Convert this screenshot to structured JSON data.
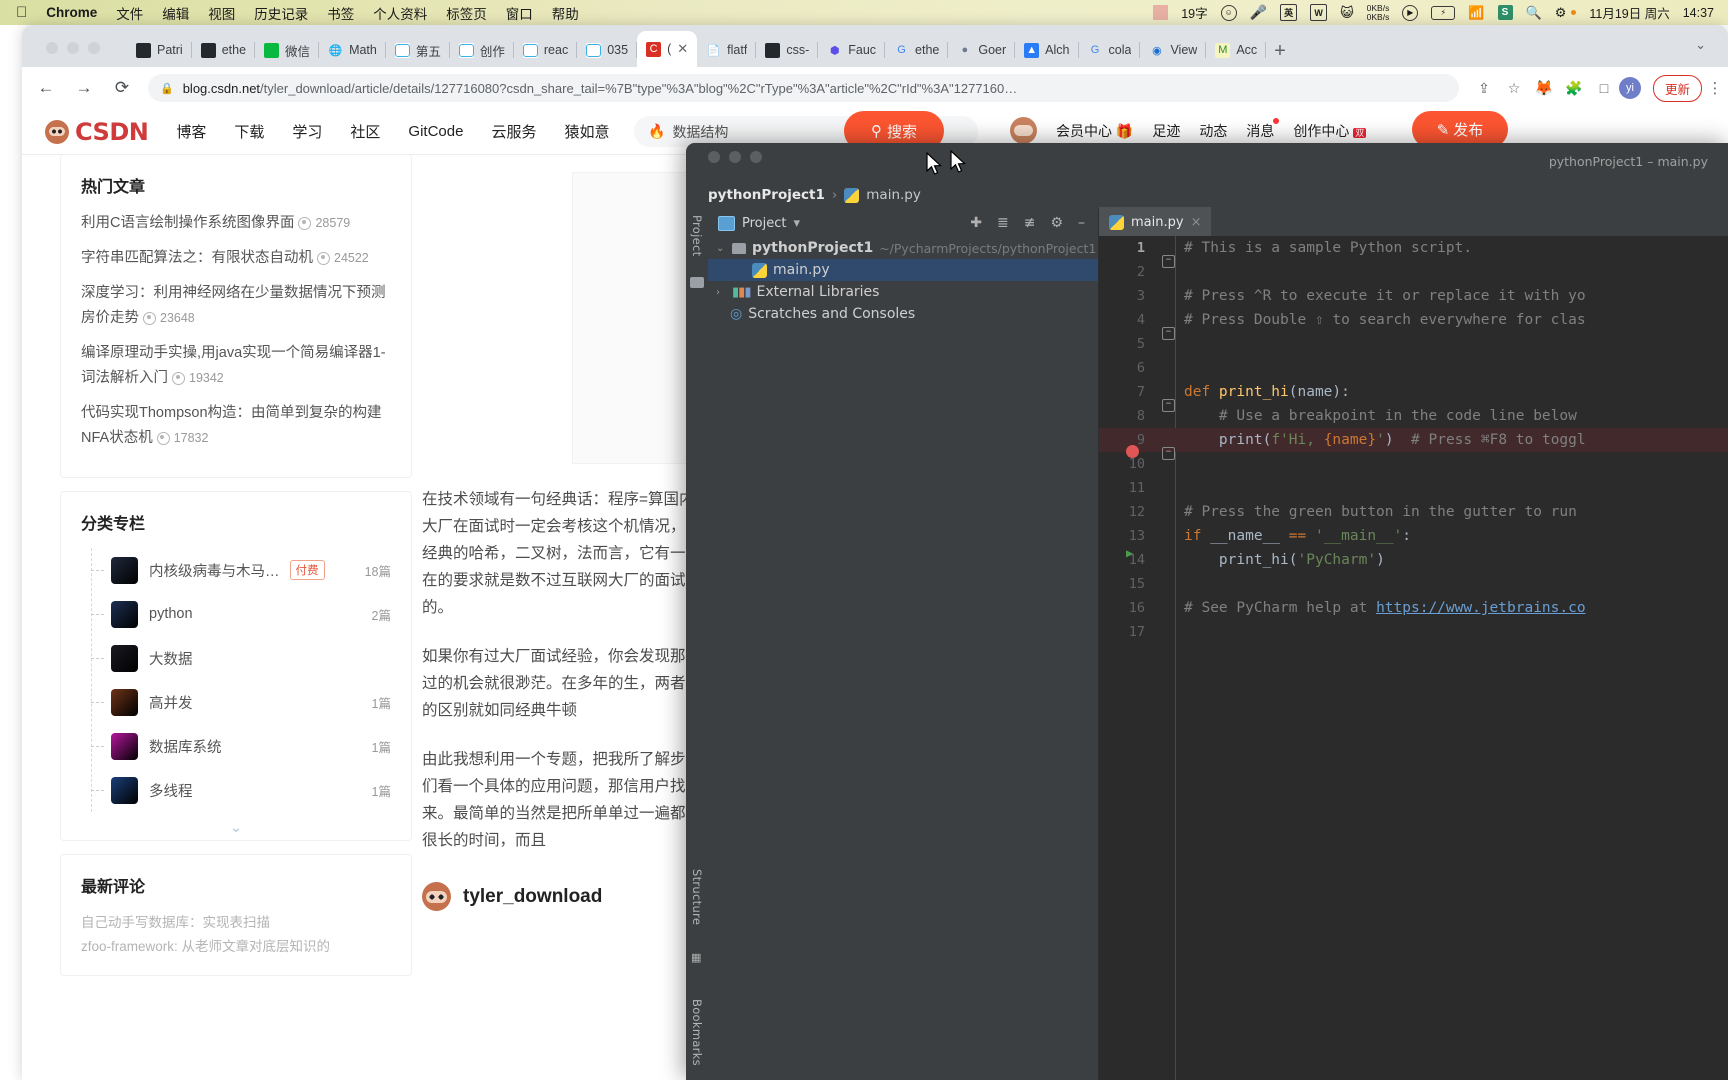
{
  "menubar": {
    "apple": "apple-logo",
    "items": [
      "Chrome",
      "文件",
      "编辑",
      "视图",
      "历史记录",
      "书签",
      "个人资料",
      "标签页",
      "窗口",
      "帮助"
    ],
    "tray": {
      "word_count": "19字",
      "input_method": "英",
      "word_app": "W",
      "netspeed_up": "0KB/s",
      "netspeed_down": "0KB/s",
      "sogou": "S",
      "date": "11月19日 周六",
      "time": "14:37"
    }
  },
  "chrome": {
    "tabs": [
      {
        "icon": "github",
        "label": "Patri"
      },
      {
        "icon": "github",
        "label": "ethe"
      },
      {
        "icon": "wechat",
        "label": "微信"
      },
      {
        "icon": "globe",
        "label": "Math"
      },
      {
        "icon": "bilibili",
        "label": "第五"
      },
      {
        "icon": "bilibili",
        "label": "创作"
      },
      {
        "icon": "bilibili",
        "label": "reac"
      },
      {
        "icon": "bilibili",
        "label": "035"
      },
      {
        "icon": "csdn",
        "label": "(",
        "active": true
      },
      {
        "icon": "doc",
        "label": "flatf"
      },
      {
        "icon": "github",
        "label": "css-"
      },
      {
        "icon": "faucet",
        "label": "Fauc"
      },
      {
        "icon": "google",
        "label": "ethe"
      },
      {
        "icon": "goer",
        "label": "Goer"
      },
      {
        "icon": "alch",
        "label": "Alch"
      },
      {
        "icon": "google",
        "label": "cola"
      },
      {
        "icon": "view",
        "label": "View"
      },
      {
        "icon": "acco",
        "label": "Acc"
      }
    ],
    "new_tab": "+",
    "tab_list": "⌄",
    "nav": {
      "back": "←",
      "forward": "→",
      "reload": "⟳"
    },
    "omnibox": {
      "lock": "lock-icon",
      "host": "blog.csdn.net",
      "path": "/tyler_download/article/details/127716080?csdn_share_tail=%7B\"type\"%3A\"blog\"%2C\"rType\"%3A\"article\"%2C\"rId\"%3A\"1277160…"
    },
    "toolbar_icons": [
      "share-icon",
      "bookmark-star-icon",
      "metamask-icon",
      "extensions-icon",
      "sidepanel-icon"
    ],
    "profile_initial": "yi",
    "update_label": "更新",
    "kebab": "⋮"
  },
  "csdn": {
    "logo_text": "CSDN",
    "nav": [
      "博客",
      "下载",
      "学习",
      "社区",
      "GitCode",
      "云服务",
      "猿如意"
    ],
    "search_placeholder": "数据结构",
    "search_button": "搜索",
    "right_nav": [
      "会员中心",
      "足迹",
      "动态",
      "消息",
      "创作中心"
    ],
    "publish_button": "发布",
    "hot_articles": {
      "title": "热门文章",
      "items": [
        {
          "title": "利用C语言绘制操作系统图像界面",
          "views": "28579"
        },
        {
          "title": "字符串匹配算法之：有限状态自动机",
          "views": "24522"
        },
        {
          "title": "深度学习：利用神经网络在少量数据情况下预测房价走势",
          "views": "23648"
        },
        {
          "title": "编译原理动手实操,用java实现一个简易编译器1-词法解析入门",
          "views": "19342"
        },
        {
          "title": "代码实现Thompson构造：由简单到复杂的构建NFA状态机",
          "views": "17832"
        }
      ]
    },
    "columns": {
      "title": "分类专栏",
      "items": [
        {
          "name": "内核级病毒与木马…",
          "tag": "付费",
          "count": "18篇",
          "color": "#20283c"
        },
        {
          "name": "python",
          "tag": "",
          "count": "2篇",
          "color": "#1d2f52"
        },
        {
          "name": "大数据",
          "tag": "",
          "count": "",
          "color": "#1a1a22"
        },
        {
          "name": "高并发",
          "tag": "",
          "count": "1篇",
          "color": "#6e3418"
        },
        {
          "name": "数据库系统",
          "tag": "",
          "count": "1篇",
          "color": "#b5179e"
        },
        {
          "name": "多线程",
          "tag": "",
          "count": "1篇",
          "color": "#1b3f7a"
        }
      ],
      "expand": "⌄"
    },
    "comments": {
      "title": "最新评论",
      "items": [
        "自己动手写数据库：实现表扫描",
        "zfoo-framework: 从老师文章对底层知识的"
      ]
    },
    "article": {
      "image_caption": "",
      "paragraphs": [
        "在技术领域有一句经典话：程序=算国内外大厂在面试时一定会考核这个机情况，例如经典的哈希，二叉树，法而言，它有一个潜在的要求就是数不过互联网大厂的面试考核的。",
        "如果你有过大厂面试经验，你会发现那么通过的机会就很渺茫。在多年的生，两者之间的区别就如同经典牛顿",
        "由此我想利用一个专题，把我所了解步。我们看一个具体的应用问题，那信用户找出来。最简单的当然是把所单单过一遍都需要很长的时间，而且"
      ],
      "author": "tyler_download"
    }
  },
  "pycharm": {
    "window_title": "pythonProject1 – main.py",
    "breadcrumb": {
      "project": "pythonProject1",
      "sep": "›",
      "file": "main.py"
    },
    "project_panel": {
      "label": "Project",
      "dropdown": "▾",
      "vertical_tabs": [
        "Project",
        "Structure",
        "Bookmarks"
      ],
      "toolbar_icons": [
        "locate-icon",
        "expand-all-icon",
        "collapse-all-icon",
        "settings-gear-icon",
        "hide-icon"
      ],
      "tree": [
        {
          "label": "pythonProject1",
          "path": "~/PycharmProjects/pythonProject1",
          "indent": 0,
          "arrow": "⌄",
          "icon": "folder",
          "bold": true
        },
        {
          "label": "main.py",
          "path": "",
          "indent": 1,
          "arrow": "",
          "icon": "python-file",
          "selected": true
        },
        {
          "label": "External Libraries",
          "path": "",
          "indent": 0,
          "arrow": "›",
          "icon": "libraries"
        },
        {
          "label": "Scratches and Consoles",
          "path": "",
          "indent": 0,
          "arrow": "",
          "icon": "scratches"
        }
      ]
    },
    "editor_tab": {
      "label": "main.py",
      "close": "×"
    },
    "code_lines": [
      {
        "n": "1",
        "fold": true,
        "segments": [
          {
            "t": "# This is a sample Python script.",
            "c": "cmt"
          }
        ]
      },
      {
        "n": "2",
        "segments": []
      },
      {
        "n": "3",
        "segments": [
          {
            "t": "# Press ^R to execute it or replace it with yo",
            "c": "cmt"
          }
        ]
      },
      {
        "n": "4",
        "fold": true,
        "segments": [
          {
            "t": "# Press Double ⇧ to search everywhere for clas",
            "c": "cmt"
          }
        ]
      },
      {
        "n": "5",
        "segments": []
      },
      {
        "n": "6",
        "segments": []
      },
      {
        "n": "7",
        "fold": true,
        "segments": [
          {
            "t": "def ",
            "c": "kw"
          },
          {
            "t": "print_hi",
            "c": "fn"
          },
          {
            "t": "(name):",
            "c": "plain"
          }
        ]
      },
      {
        "n": "8",
        "segments": [
          {
            "t": "    # Use a breakpoint in the code line below",
            "c": "cmt"
          }
        ]
      },
      {
        "n": "9",
        "breakpoint": true,
        "fold": true,
        "segments": [
          {
            "t": "    ",
            "c": "plain"
          },
          {
            "t": "print",
            "c": "fnv"
          },
          {
            "t": "(",
            "c": "plain"
          },
          {
            "t": "f'Hi, ",
            "c": "str"
          },
          {
            "t": "{name}",
            "c": "kw"
          },
          {
            "t": "'",
            "c": "str"
          },
          {
            "t": ")  ",
            "c": "plain"
          },
          {
            "t": "# Press ⌘F8 to toggl",
            "c": "cmt"
          }
        ]
      },
      {
        "n": "10",
        "segments": []
      },
      {
        "n": "11",
        "segments": []
      },
      {
        "n": "12",
        "segments": [
          {
            "t": "# Press the green button in the gutter to run",
            "c": "cmt"
          }
        ]
      },
      {
        "n": "13",
        "run": true,
        "segments": [
          {
            "t": "if ",
            "c": "kw"
          },
          {
            "t": "__name__ ",
            "c": "plain"
          },
          {
            "t": "== ",
            "c": "kw"
          },
          {
            "t": "'__main__'",
            "c": "str"
          },
          {
            "t": ":",
            "c": "plain"
          }
        ]
      },
      {
        "n": "14",
        "segments": [
          {
            "t": "    ",
            "c": "plain"
          },
          {
            "t": "print_hi",
            "c": "plain"
          },
          {
            "t": "(",
            "c": "plain"
          },
          {
            "t": "'PyCharm'",
            "c": "str"
          },
          {
            "t": ")",
            "c": "plain"
          }
        ]
      },
      {
        "n": "15",
        "segments": []
      },
      {
        "n": "16",
        "segments": [
          {
            "t": "# See PyCharm help at ",
            "c": "cmt"
          },
          {
            "t": "https://www.jetbrains.co",
            "c": "link"
          }
        ]
      },
      {
        "n": "17",
        "segments": []
      }
    ]
  },
  "colors": {
    "chrome_bg": "#dee1e6",
    "csdn_red": "#fc5531",
    "pycharm_bg": "#3c3f41",
    "editor_bg": "#2b2b2b",
    "selection_blue": "#2f4a6d",
    "breakpoint_red": "#e05555"
  }
}
